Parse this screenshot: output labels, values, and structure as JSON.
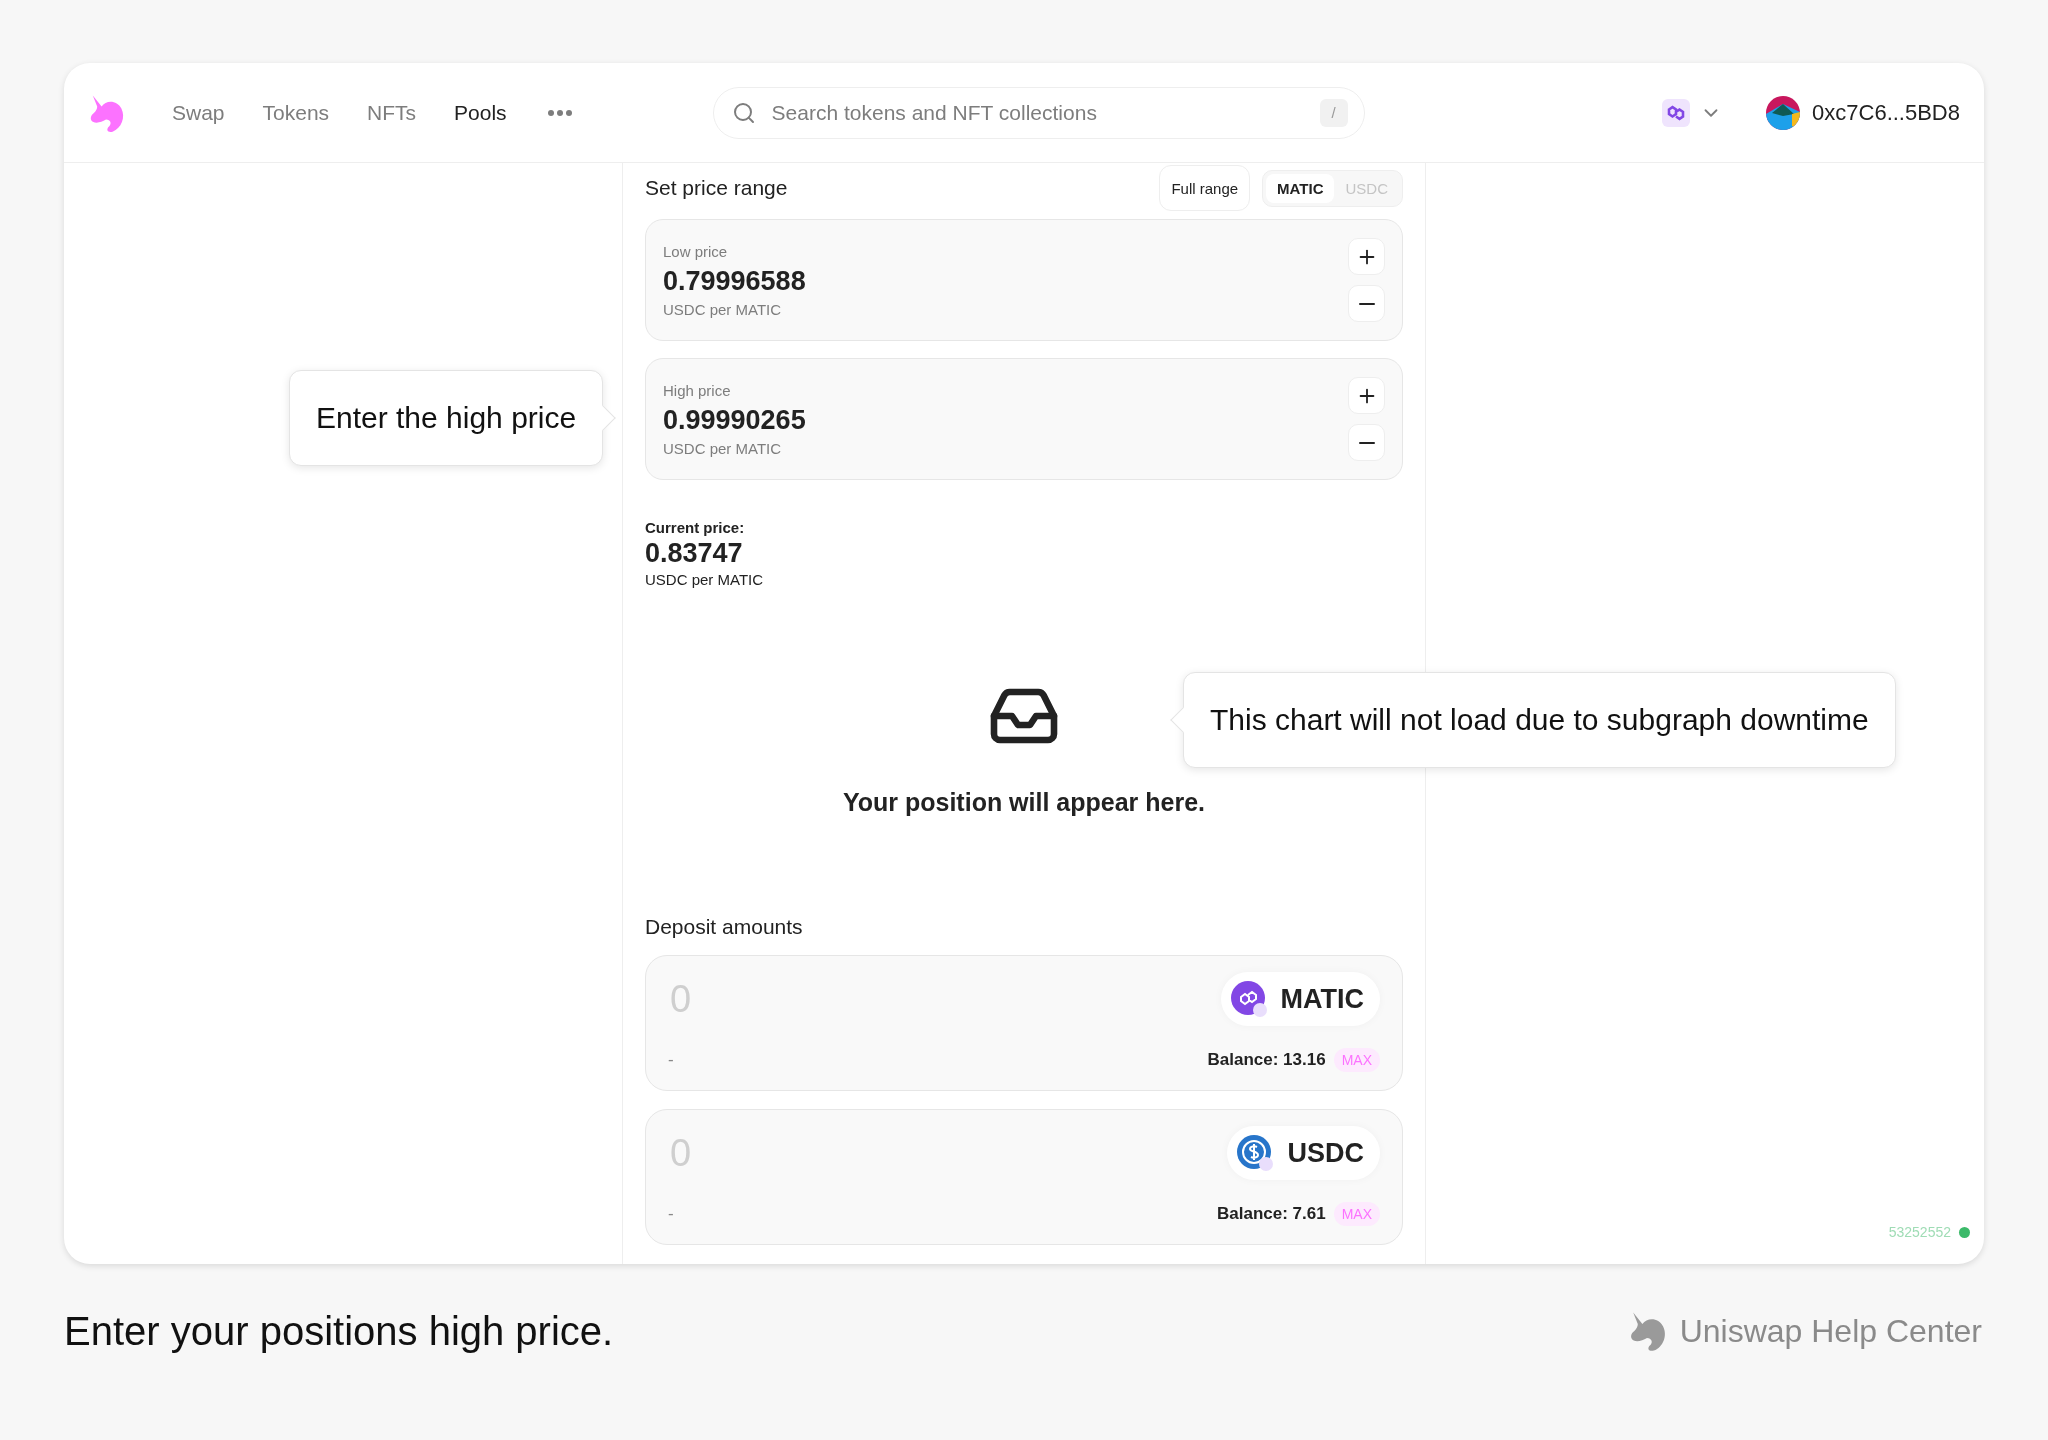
{
  "nav": {
    "items": [
      {
        "label": "Swap",
        "selected": false
      },
      {
        "label": "Tokens",
        "selected": false
      },
      {
        "label": "NFTs",
        "selected": false
      },
      {
        "label": "Pools",
        "selected": true
      }
    ]
  },
  "search": {
    "placeholder": "Search tokens and NFT collections",
    "shortcut": "/"
  },
  "account": {
    "address": "0xc7C6...5BD8"
  },
  "price_range": {
    "title": "Set price range",
    "full_range": "Full range",
    "tokens": [
      {
        "label": "MATIC",
        "selected": true
      },
      {
        "label": "USDC",
        "selected": false
      }
    ],
    "inputs": [
      {
        "label": "Low price",
        "value": "0.79996588",
        "unit": "USDC per MATIC"
      },
      {
        "label": "High price",
        "value": "0.99990265",
        "unit": "USDC per MATIC"
      }
    ]
  },
  "current_price": {
    "label": "Current price:",
    "value": "0.83747",
    "unit": "USDC per MATIC"
  },
  "empty_state": {
    "message": "Your position will appear here."
  },
  "deposit": {
    "title": "Deposit amounts",
    "items": [
      {
        "placeholder": "0",
        "fiat": "-",
        "token": "MATIC",
        "kind": "matic",
        "balance": "Balance: 13.16",
        "max": "MAX"
      },
      {
        "placeholder": "0",
        "fiat": "-",
        "token": "USDC",
        "kind": "usdc",
        "balance": "Balance: 7.61",
        "max": "MAX"
      }
    ]
  },
  "block": {
    "number": "53252552",
    "color": "#3cba6a"
  },
  "callouts": [
    {
      "text": "Enter the high price",
      "kind": "right"
    },
    {
      "text": "This chart will not load due to subgraph downtime",
      "kind": "left"
    }
  ],
  "caption": "Enter your positions high price.",
  "help_center": "Uniswap Help Center"
}
